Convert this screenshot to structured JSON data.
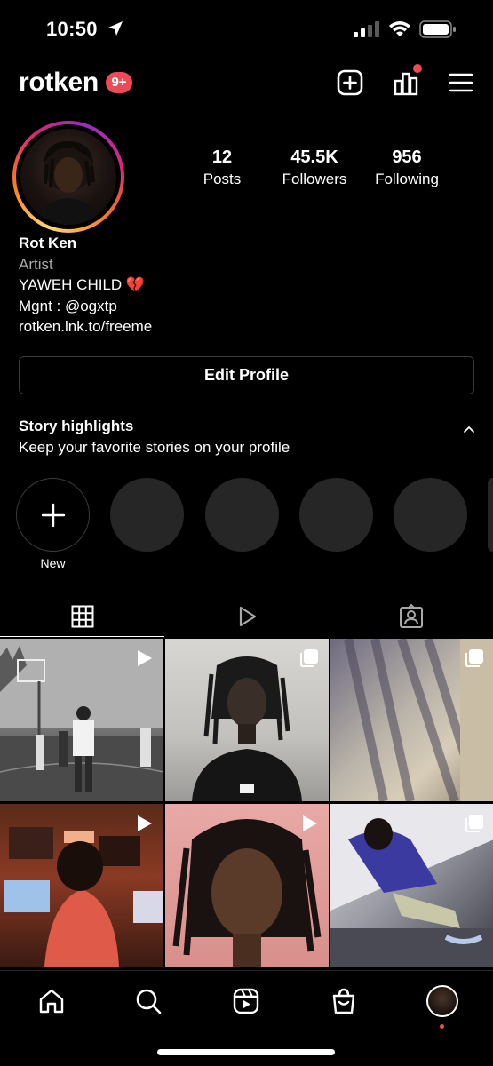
{
  "status_bar": {
    "time": "10:50"
  },
  "header": {
    "username": "rotken",
    "notification_badge": "9+",
    "icons": [
      "plus-square-icon",
      "insights-icon",
      "hamburger-menu-icon"
    ]
  },
  "profile": {
    "stats": {
      "posts": {
        "value": "12",
        "label": "Posts"
      },
      "followers": {
        "value": "45.5K",
        "label": "Followers"
      },
      "following": {
        "value": "956",
        "label": "Following"
      }
    },
    "bio": {
      "name": "Rot Ken",
      "category": "Artist",
      "line1": "YAWEH CHILD 💔",
      "line2": "Mgnt : @ogxtp",
      "link": "rotken.lnk.to/freeme"
    },
    "edit_button": "Edit Profile"
  },
  "highlights": {
    "title": "Story highlights",
    "subtitle": "Keep your favorite stories on your profile",
    "new_label": "New",
    "placeholder_count": 4
  },
  "tabs": [
    "posts-grid-tab",
    "reels-tab",
    "tagged-tab"
  ],
  "posts": [
    {
      "type": "reel"
    },
    {
      "type": "carousel"
    },
    {
      "type": "carousel"
    },
    {
      "type": "reel"
    },
    {
      "type": "reel"
    },
    {
      "type": "carousel"
    }
  ],
  "bottom_nav": [
    "home",
    "search",
    "reels",
    "shop",
    "profile"
  ],
  "colors": {
    "accent_red": "#ed4956",
    "background": "#000000",
    "border": "#3a3a3a",
    "secondary_text": "#a8a8a8"
  }
}
